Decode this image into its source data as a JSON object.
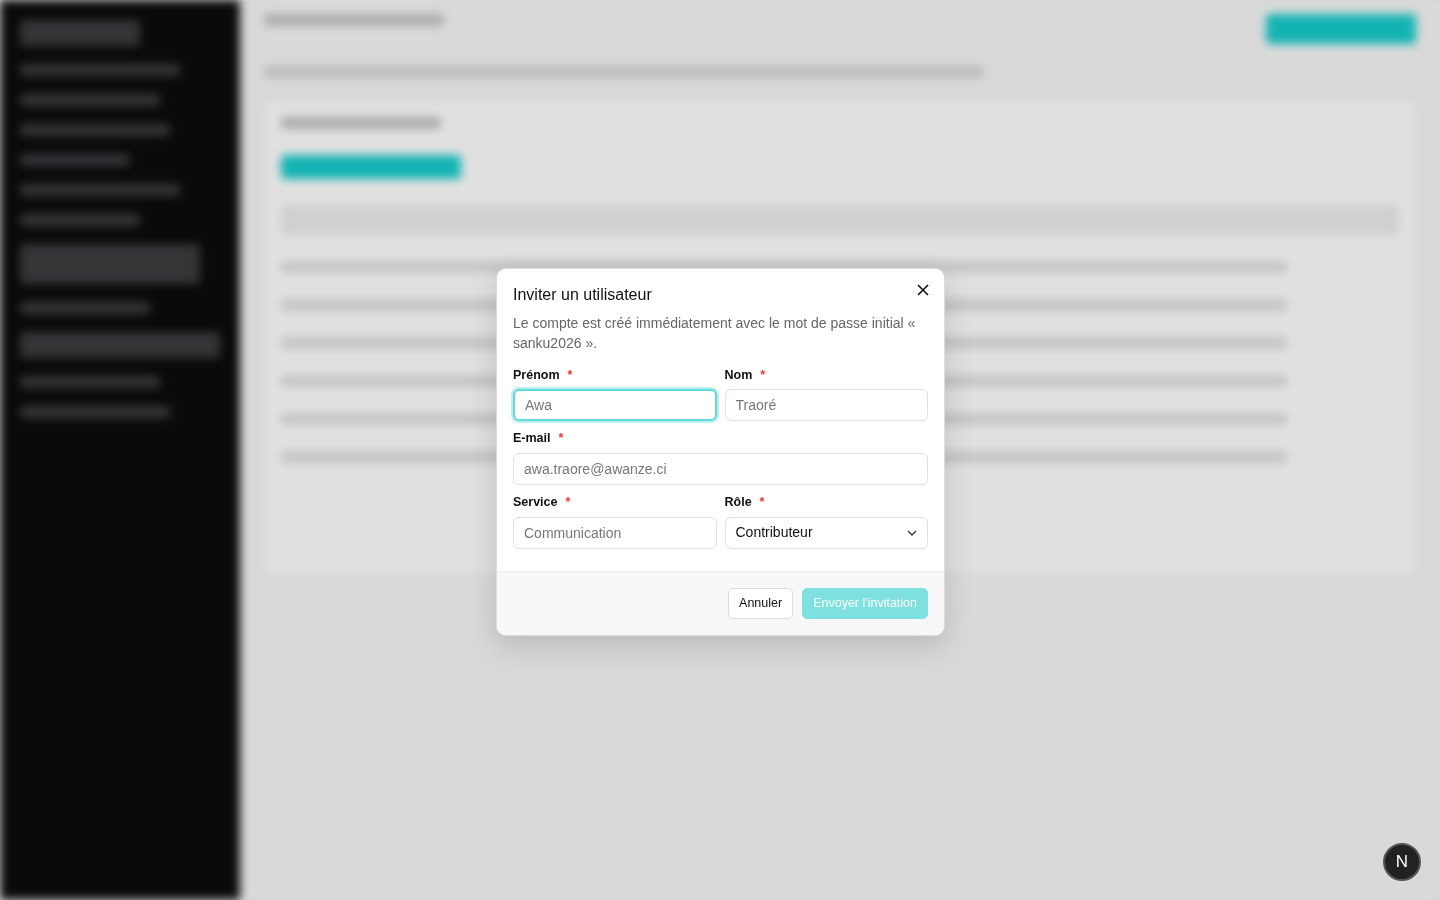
{
  "dialog": {
    "title": "Inviter un utilisateur",
    "description": "Le compte est créé immédiatement avec le mot de passe initial « sanku2026 ».",
    "fields": [
      {
        "kind": "text",
        "label": "Prénom",
        "required_mark": "*",
        "placeholder": "Awa",
        "focused": true
      },
      {
        "kind": "text",
        "label": "Nom",
        "required_mark": "*",
        "placeholder": "Traoré",
        "focused": false
      },
      {
        "kind": "email",
        "label": "E-mail",
        "required_mark": "*",
        "placeholder": "awa.traore@awanze.ci",
        "focused": false
      },
      {
        "kind": "text",
        "label": "Service",
        "required_mark": "*",
        "placeholder": "Communication",
        "focused": false
      },
      {
        "kind": "select",
        "label": "Rôle",
        "required_mark": "*",
        "value": "Contributeur",
        "focused": false
      }
    ],
    "buttons": [
      {
        "kind": "secondary",
        "label": "Annuler",
        "disabled": false
      },
      {
        "kind": "primary",
        "label": "Envoyer l'invitation",
        "disabled": true
      }
    ]
  },
  "dev_badge": "N"
}
